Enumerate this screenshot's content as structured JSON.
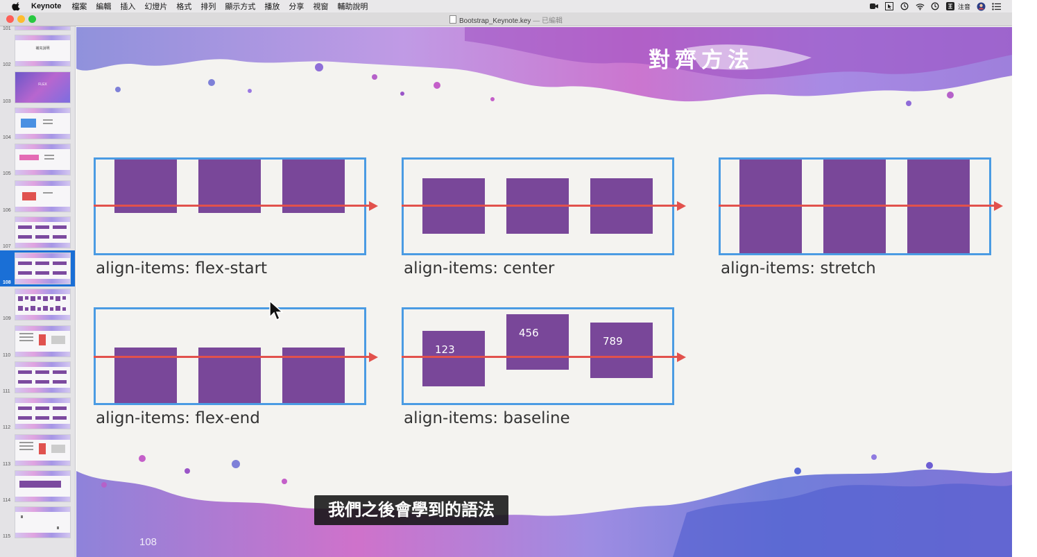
{
  "menubar": {
    "items": [
      "Keynote",
      "檔案",
      "編輯",
      "插入",
      "幻燈片",
      "格式",
      "排列",
      "顯示方式",
      "播放",
      "分享",
      "視窗",
      "輔助說明"
    ],
    "status_icons": [
      "zoom-icon",
      "cursor-box-icon",
      "time-machine-icon",
      "wifi-icon",
      "clock-icon",
      "input-method-icon",
      "user-icon",
      "menu-list-icon"
    ],
    "ime_label": "注音"
  },
  "window": {
    "title": "Bootstrap_Keynote.key",
    "edited_suffix": " — 已編輯",
    "traffic_colors": [
      "#fe5f57",
      "#febc2e",
      "#28c840"
    ]
  },
  "navigator": {
    "selected": "108",
    "slides": [
      {
        "number": "101"
      },
      {
        "number": "102",
        "thumb_title": "補充說明"
      },
      {
        "number": "103",
        "thumb_title": "FLEX"
      },
      {
        "number": "104"
      },
      {
        "number": "105"
      },
      {
        "number": "106"
      },
      {
        "number": "107"
      },
      {
        "number": "108"
      },
      {
        "number": "109"
      },
      {
        "number": "110"
      },
      {
        "number": "111"
      },
      {
        "number": "112"
      },
      {
        "number": "113"
      },
      {
        "number": "114"
      },
      {
        "number": "115"
      }
    ]
  },
  "slide": {
    "title": "對齊方法",
    "number": "108",
    "demos": [
      {
        "label": "align-items: flex-start",
        "align": "flex-start",
        "numbers": []
      },
      {
        "label": "align-items: center",
        "align": "center",
        "numbers": []
      },
      {
        "label": "align-items: stretch",
        "align": "stretch",
        "numbers": []
      },
      {
        "label": "align-items: flex-end",
        "align": "flex-end",
        "numbers": []
      },
      {
        "label": "align-items: baseline",
        "align": "baseline",
        "numbers": [
          "123",
          "456",
          "789"
        ]
      }
    ],
    "colors": {
      "box_border": "#4a9be3",
      "item": "#794799",
      "axis": "#e2514c"
    }
  },
  "subtitle": "我們之後會學到的語法"
}
